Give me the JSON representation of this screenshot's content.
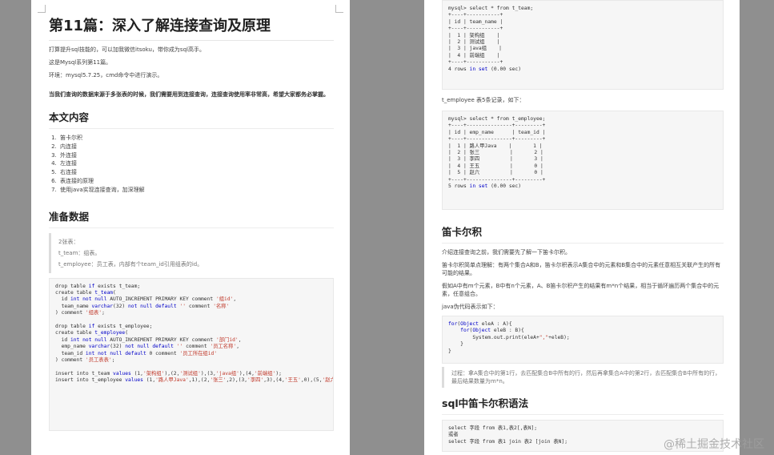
{
  "left": {
    "title": "第11篇：深入了解连接查询及原理",
    "intro": [
      "打算提升sql技能的，可以加我微信itsoku，带你成为sql高手。",
      "这是Mysql系列第11篇。",
      "环境：mysql5.7.25，cmd命令中进行演示。"
    ],
    "note": "当我们查询的数据来源于多张表的时候，我们需要用到连接查询，连接查询使用率非常高，希望大家都务必掌握。",
    "toc_heading": "本文内容",
    "toc_items": [
      "笛卡尔积",
      "内连接",
      "外连接",
      "左连接",
      "右连接",
      "表连接的原理",
      "使用java实现连接查询，加深理解"
    ],
    "prep_heading": "准备数据",
    "quote": [
      "2张表：",
      "t_team：组表。",
      "t_employee：员工表，内部有个team_id引用组表的id。"
    ]
  },
  "right": {
    "emp_intro": "t_employee 表5条记录，如下：",
    "cart_heading": "笛卡尔积",
    "cart_p1": "介绍连接查询之前，我们需要先了解一下笛卡尔积。",
    "cart_p2": "笛卡尔积简单点理解：有两个集合A和B，笛卡尔积表示A集合中的元素和B集合中的元素任意相互关联产生的所有可能的结果。",
    "cart_p3": "假如A中有m个元素，B中有n个元素，A、B笛卡尔积产生的结果有m*n个结果，相当于循环遍历两个集合中的元素，任意组合。",
    "java_intro": "java伪代码表示如下：",
    "quote": "过程：拿A集合中的第1行，去匹配集合B中所有的行，然后再拿集合A中的第2行，去匹配集合B中所有的行，最后结果数量为m*n。",
    "sql_heading": "sql中笛卡尔积语法"
  },
  "watermark": "@稀土掘金技术社区"
}
